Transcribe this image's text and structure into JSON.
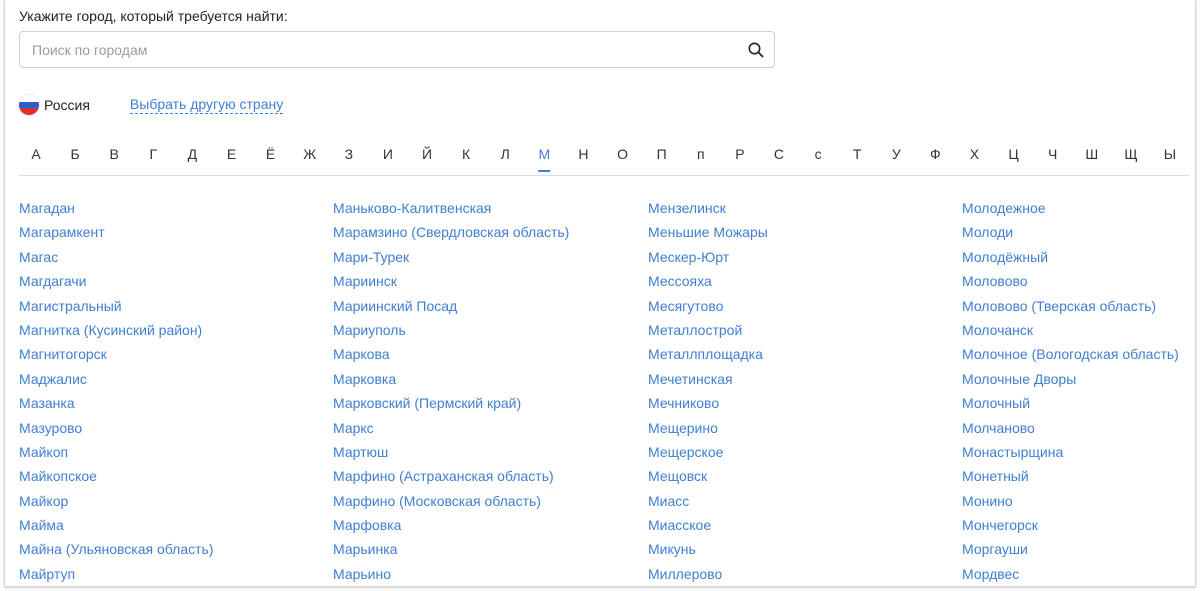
{
  "prompt_label": "Укажите город, который требуется найти:",
  "search": {
    "placeholder": "Поиск по городам",
    "value": "",
    "icon": "search-icon"
  },
  "country": {
    "name": "Россия",
    "flag_colors": [
      "#ffffff",
      "#2d5ec9",
      "#d6322d"
    ],
    "change_label": "Выбрать другую страну"
  },
  "alphabet": {
    "letters": [
      "А",
      "Б",
      "В",
      "Г",
      "Д",
      "Е",
      "Ё",
      "Ж",
      "З",
      "И",
      "Й",
      "К",
      "Л",
      "М",
      "Н",
      "О",
      "П",
      "п",
      "Р",
      "С",
      "с",
      "Т",
      "У",
      "Ф",
      "Х",
      "Ц",
      "Ч",
      "Ш",
      "Щ",
      "Ы"
    ],
    "active": "М"
  },
  "colors": {
    "accent": "#3f7fd0",
    "text": "#222222"
  },
  "cities": [
    [
      "Магадан",
      "Магарамкент",
      "Магас",
      "Магдагачи",
      "Магистральный",
      "Магнитка (Кусинский район)",
      "Магнитогорск",
      "Маджалис",
      "Мазанка",
      "Мазурово",
      "Майкоп",
      "Майкопское",
      "Майкор",
      "Майма",
      "Майна (Ульяновская область)",
      "Майртуп"
    ],
    [
      "Маньково-Калитвенская",
      "Марамзино (Свердловская область)",
      "Мари-Турек",
      "Мариинск",
      "Мариинский Посад",
      "Мариуполь",
      "Маркова",
      "Марковка",
      "Марковский (Пермский край)",
      "Маркс",
      "Мартюш",
      "Марфино (Астраханская область)",
      "Марфино (Московская область)",
      "Марфовка",
      "Марьинка",
      "Марьино"
    ],
    [
      "Мензелинск",
      "Меньшие Можары",
      "Мескер-Юрт",
      "Мессояха",
      "Месягутово",
      "Металлострой",
      "Металлплощадка",
      "Мечетинская",
      "Мечниково",
      "Мещерино",
      "Мещерское",
      "Мещовск",
      "Миасс",
      "Миасское",
      "Микунь",
      "Миллерово"
    ],
    [
      "Молодежное",
      "Молоди",
      "Молодёжный",
      "Моловово",
      "Моловово (Тверская область)",
      "Молочанск",
      "Молочное (Вологодская область)",
      "Молочные Дворы",
      "Молочный",
      "Молчаново",
      "Монастырщина",
      "Монетный",
      "Монино",
      "Мончегорск",
      "Моргауши",
      "Мордвес"
    ]
  ]
}
